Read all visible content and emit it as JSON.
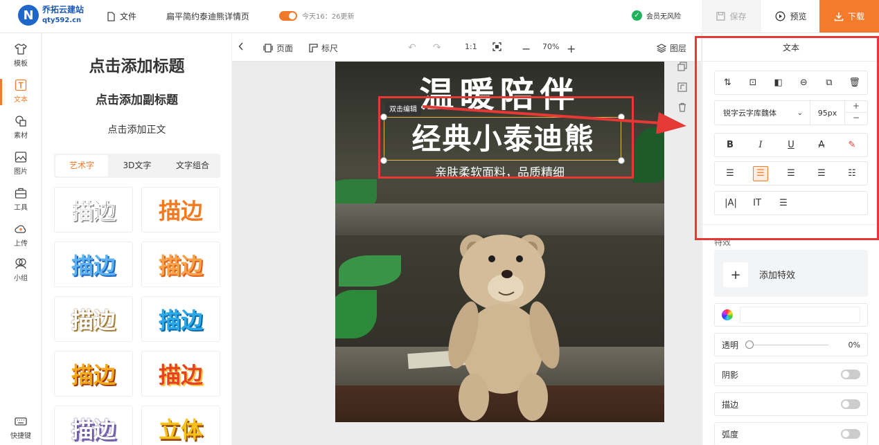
{
  "header": {
    "logo_mark": "N",
    "logo_name": "乔拓云建站",
    "logo_site": "qty592.cn",
    "file_label": "文件",
    "doc_title": "扁平简约泰迪熊详情页",
    "autosave_text": "今天16：26更新",
    "member_text": "会员无风险",
    "save_label": "保存",
    "preview_label": "预览",
    "download_label": "下载"
  },
  "rail": {
    "items": [
      {
        "label": "模板"
      },
      {
        "label": "文本"
      },
      {
        "label": "素材"
      },
      {
        "label": "图片"
      },
      {
        "label": "工具"
      },
      {
        "label": "上传"
      },
      {
        "label": "小组"
      }
    ],
    "shortcut_label": "快捷键"
  },
  "panel": {
    "add_title": "点击添加标题",
    "add_subtitle": "点击添加副标题",
    "add_body": "点击添加正文",
    "tabs": [
      {
        "label": "艺术字"
      },
      {
        "label": "3D文字"
      },
      {
        "label": "文字组合"
      }
    ],
    "art_cards": [
      {
        "text": "描边"
      },
      {
        "text": "描边"
      },
      {
        "text": "描边"
      },
      {
        "text": "描边"
      },
      {
        "text": "描边"
      },
      {
        "text": "描边"
      },
      {
        "text": "描边"
      },
      {
        "text": "描边"
      },
      {
        "text": "描边"
      },
      {
        "text": "立体"
      }
    ]
  },
  "canvas_toolbar": {
    "page_label": "页面",
    "ruler_label": "标尺",
    "ratio_label": "1:1",
    "zoom_label": "70%",
    "layers_label": "图层"
  },
  "poster": {
    "title1": "温暖陪伴",
    "title2": "经典小泰迪熊",
    "subtitle": "亲肤柔软面料，品质精细",
    "edit_tag": "双击编辑"
  },
  "right_panel": {
    "title": "文本",
    "font_name": "锐字云字库魏体",
    "font_size": "95px",
    "effects_label": "特效",
    "add_effect_label": "添加特效",
    "opacity_label": "透明",
    "opacity_value": "0%",
    "shadow_label": "阴影",
    "stroke_label": "描边",
    "curve_label": "弧度"
  },
  "colors": {
    "accent": "#f57b2c",
    "annotation_red": "#e53935"
  }
}
